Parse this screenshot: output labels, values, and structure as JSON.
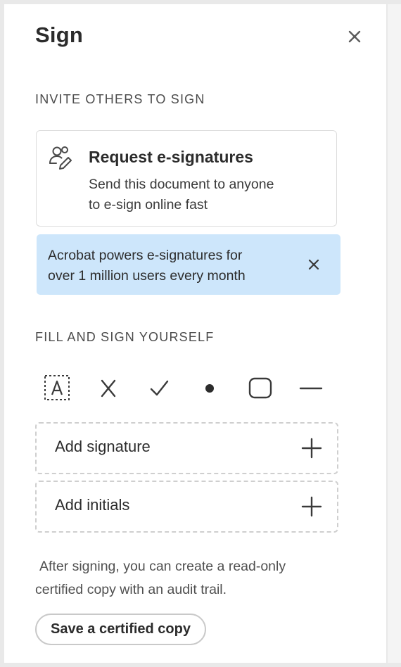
{
  "panel": {
    "title": "Sign",
    "close_icon": "close-icon"
  },
  "invite_section": {
    "label": "INVITE OTHERS TO SIGN",
    "request_card": {
      "icon": "people-sign-icon",
      "title": "Request e-signatures",
      "description_line1": "Send this document to anyone",
      "description_line2": "to e-sign online fast"
    },
    "info_banner": {
      "line1": "Acrobat powers e-signatures for",
      "line2": "over 1 million users every month",
      "close_icon": "close-icon"
    }
  },
  "fill_section": {
    "label": "FILL AND SIGN YOURSELF",
    "tools": [
      {
        "icon": "text-field-icon"
      },
      {
        "icon": "cross-mark-icon"
      },
      {
        "icon": "checkmark-icon"
      },
      {
        "icon": "dot-icon"
      },
      {
        "icon": "rounded-rectangle-icon"
      },
      {
        "icon": "line-icon"
      }
    ],
    "add_signature_label": "Add signature",
    "add_initials_label": "Add initials",
    "after_text_line1": "After signing, you can create a read-only",
    "after_text_line2": "certified copy with an audit trail.",
    "save_button_label": "Save a certified copy"
  },
  "colors": {
    "banner_background": "#cde6fb",
    "text_primary": "#2c2c2c"
  }
}
